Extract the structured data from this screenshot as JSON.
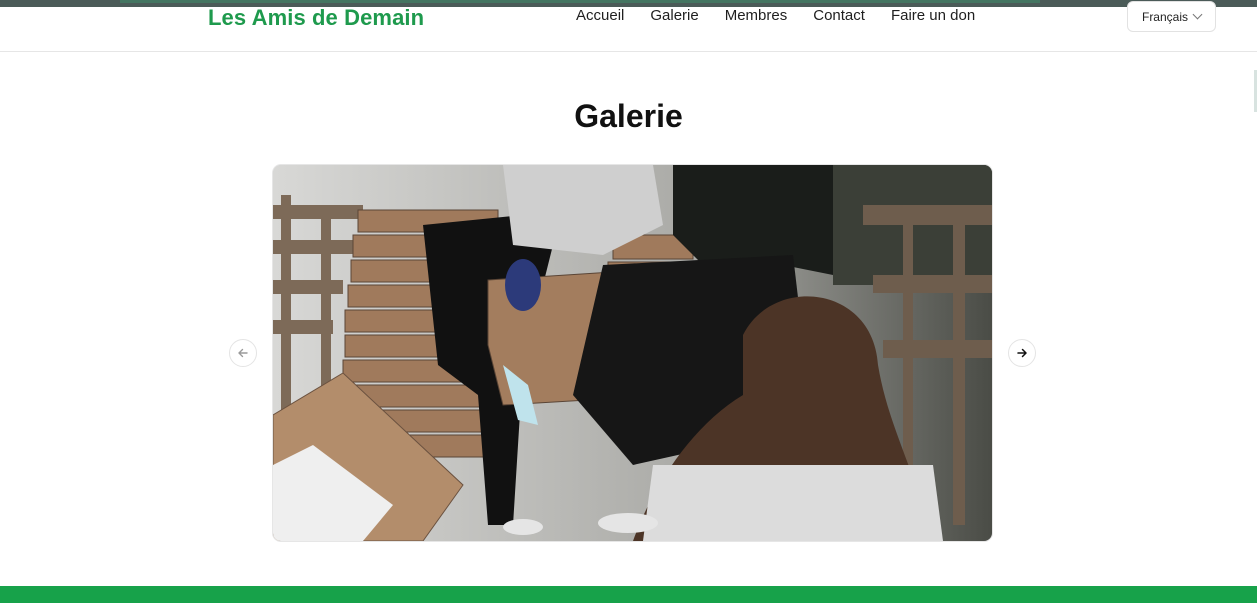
{
  "brand": {
    "name": "Les Amis de Demain",
    "color": "#1e9a4d"
  },
  "nav": {
    "items": [
      "Accueil",
      "Galerie",
      "Membres",
      "Contact",
      "Faire un don"
    ]
  },
  "language": {
    "selected": "Français"
  },
  "page": {
    "title": "Galerie"
  },
  "carousel": {
    "image_subject": "volunteers-unloading-boxes",
    "prev_icon": "arrow-left-icon",
    "next_icon": "arrow-right-icon"
  },
  "footer": {
    "color": "#17a24a"
  }
}
